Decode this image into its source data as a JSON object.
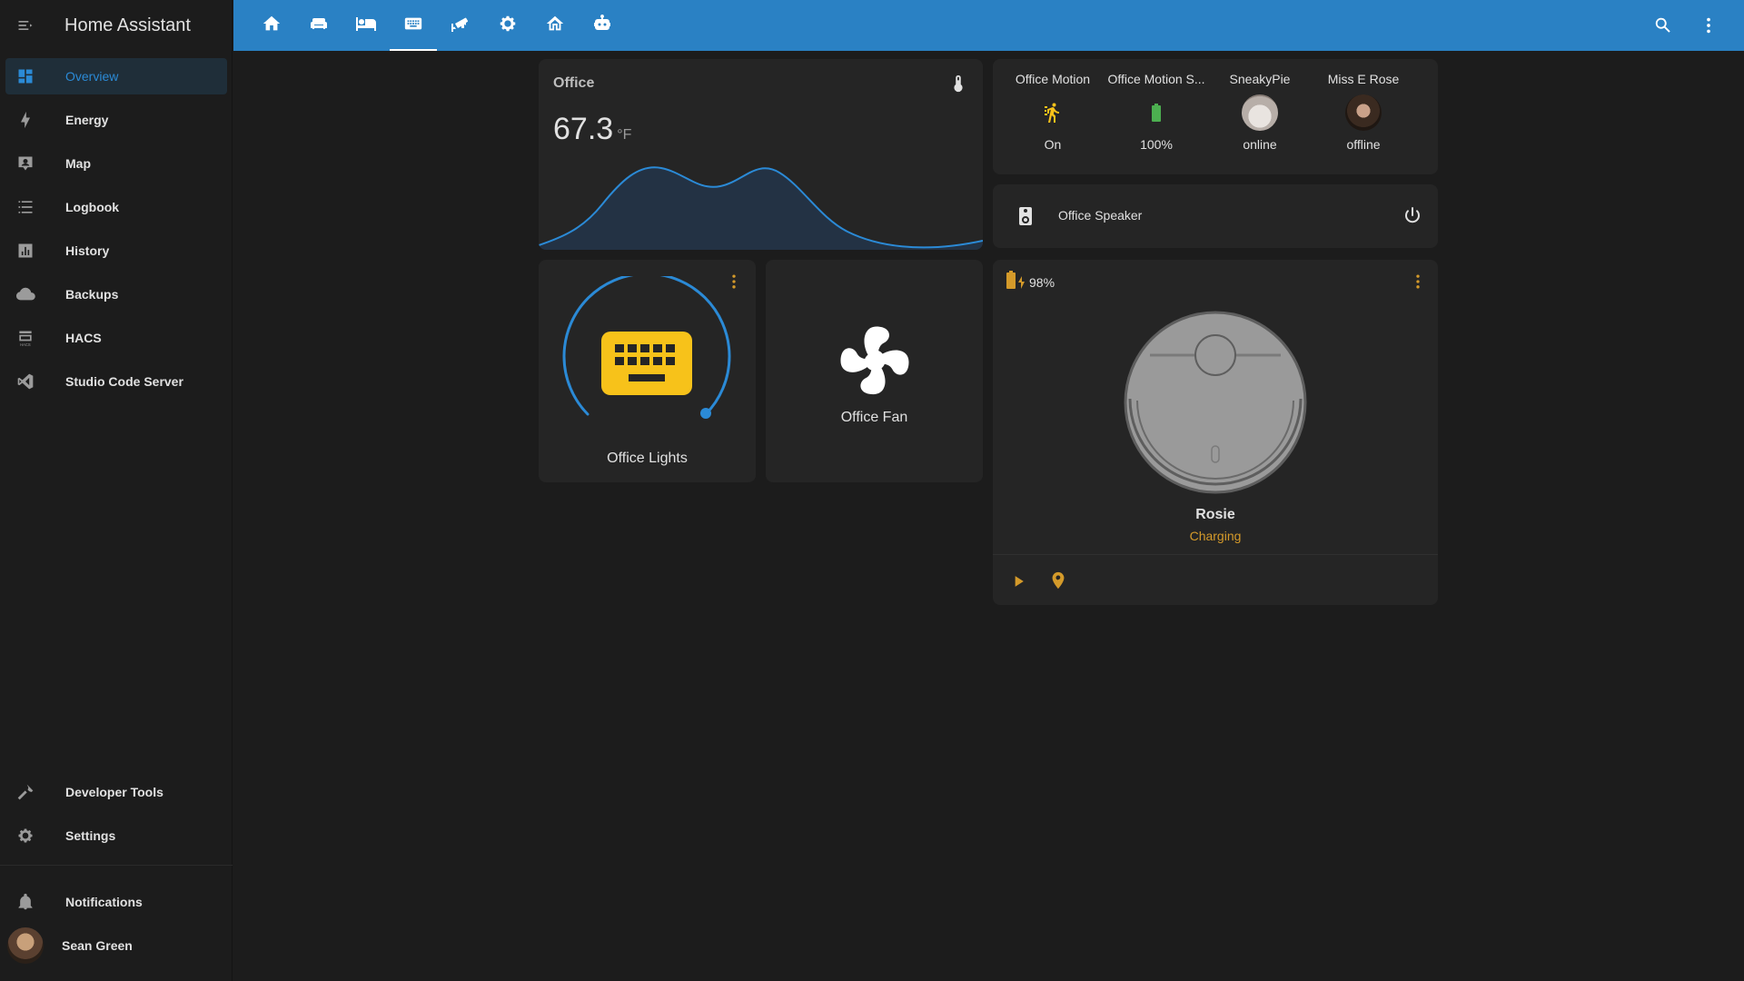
{
  "app": {
    "title": "Home Assistant"
  },
  "sidebar": {
    "items": [
      {
        "label": "Overview",
        "icon": "dashboard-icon"
      },
      {
        "label": "Energy",
        "icon": "lightning-icon"
      },
      {
        "label": "Map",
        "icon": "map-account-icon"
      },
      {
        "label": "Logbook",
        "icon": "list-icon"
      },
      {
        "label": "History",
        "icon": "chart-box-icon"
      },
      {
        "label": "Backups",
        "icon": "cloud-icon"
      },
      {
        "label": "HACS",
        "icon": "hacs-icon"
      },
      {
        "label": "Studio Code Server",
        "icon": "vscode-icon"
      }
    ],
    "bottom": [
      {
        "label": "Developer Tools",
        "icon": "hammer-icon"
      },
      {
        "label": "Settings",
        "icon": "gear-icon"
      },
      {
        "label": "Notifications",
        "icon": "bell-icon"
      },
      {
        "label": "Sean Green",
        "icon": "avatar"
      }
    ]
  },
  "colors": {
    "accent": "#2a81c4",
    "sidebar_active": "#2b8ad6",
    "card": "#252525",
    "background": "#1c1c1c",
    "light_on": "#f7c21a",
    "charging": "#d49a2a",
    "battery_green": "#4caf50"
  },
  "office_card": {
    "name": "Office",
    "value": "67.3",
    "unit": "°F"
  },
  "entities": [
    {
      "name": "Office Motion",
      "state": "On"
    },
    {
      "name": "Office Motion S...",
      "state": "100%"
    },
    {
      "name": "SneakyPie",
      "state": "online"
    },
    {
      "name": "Miss E Rose",
      "state": "offline"
    }
  ],
  "speaker": {
    "name": "Office Speaker"
  },
  "lights": {
    "name": "Office Lights"
  },
  "fan": {
    "name": "Office Fan"
  },
  "vacuum": {
    "battery": "98%",
    "name": "Rosie",
    "state": "Charging"
  }
}
